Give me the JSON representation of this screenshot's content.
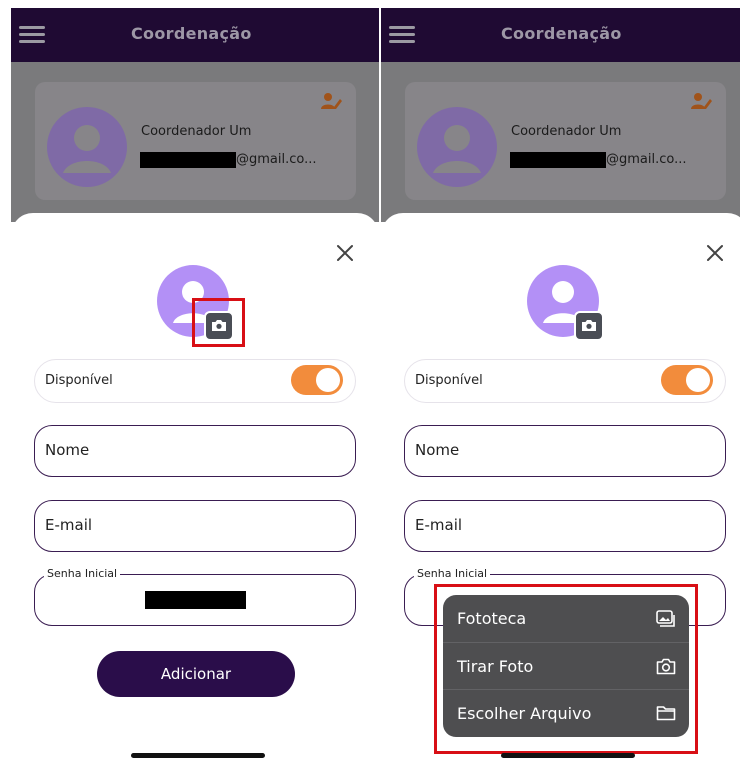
{
  "screens": [
    {
      "app_bar": {
        "title": "Coordenação"
      },
      "profile_card": {
        "name": "Coordenador Um",
        "email_suffix": "@gmail.co..."
      },
      "form": {
        "toggle_label": "Disponível",
        "toggle_on": true,
        "name_placeholder": "Nome",
        "email_placeholder": "E-mail",
        "password_label": "Senha Inicial",
        "submit_label": "Adicionar"
      }
    },
    {
      "app_bar": {
        "title": "Coordenação"
      },
      "profile_card": {
        "name": "Coordenador Um",
        "email_suffix": "@gmail.co..."
      },
      "form": {
        "toggle_label": "Disponível",
        "toggle_on": true,
        "name_placeholder": "Nome",
        "email_placeholder": "E-mail",
        "password_label": "Senha Inicial"
      },
      "photo_menu": {
        "items": [
          {
            "label": "Fototeca",
            "icon": "photo-library-icon"
          },
          {
            "label": "Tirar Foto",
            "icon": "camera-icon"
          },
          {
            "label": "Escolher Arquivo",
            "icon": "folder-icon"
          }
        ]
      }
    }
  ],
  "colors": {
    "app_bar": "#1f0a33",
    "primary": "#2a0d4a",
    "avatar": "#b390f6",
    "toggle": "#f28c3c",
    "highlight": "#d80f15",
    "menu_bg": "#4e4e50"
  }
}
